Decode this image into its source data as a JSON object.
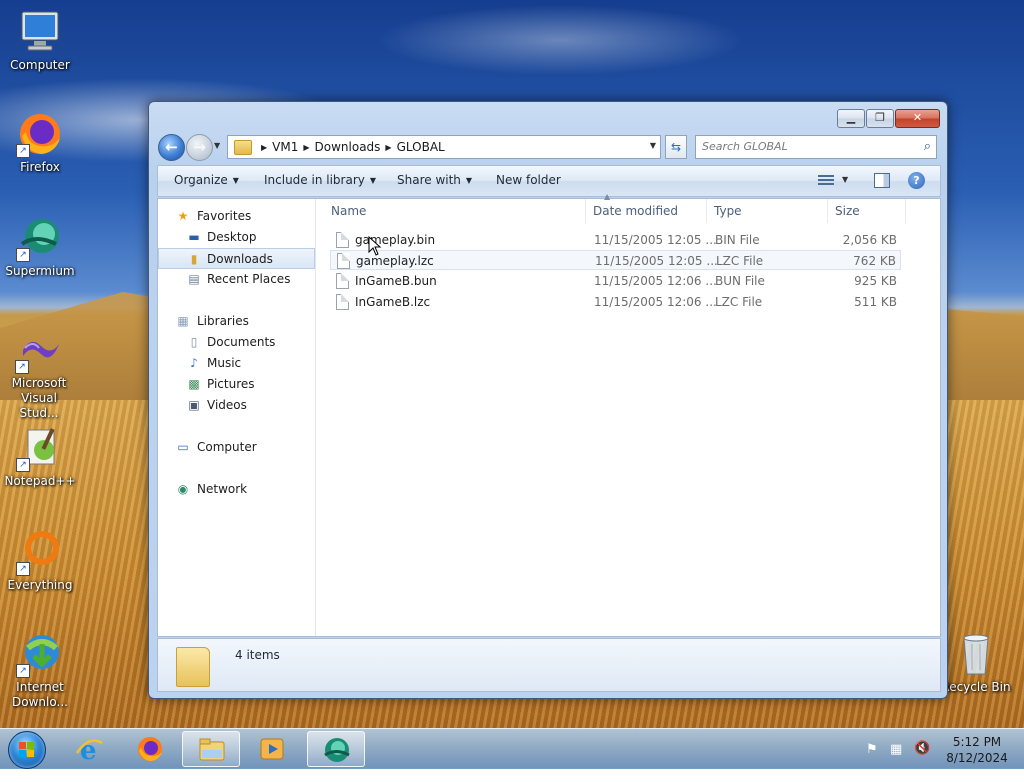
{
  "desktop": {
    "icons": [
      {
        "label": "Computer",
        "icon": "computer-icon"
      },
      {
        "label": "Firefox",
        "icon": "firefox-icon"
      },
      {
        "label": "Supermium",
        "icon": "supermium-icon"
      },
      {
        "label": "Microsoft Visual Stud...",
        "icon": "visual-studio-icon"
      },
      {
        "label": "Notepad++",
        "icon": "notepadpp-icon"
      },
      {
        "label": "Everything",
        "icon": "everything-icon"
      },
      {
        "label": "Internet Downlo...",
        "icon": "internet-download-manager-icon"
      },
      {
        "label": "Recycle Bin",
        "icon": "recycle-bin-icon"
      }
    ]
  },
  "window": {
    "address": {
      "crumbs": [
        "VM1",
        "Downloads",
        "GLOBAL"
      ]
    },
    "search": {
      "placeholder": "Search GLOBAL"
    },
    "toolbar": {
      "organize": "Organize",
      "include_in_library": "Include in library",
      "share_with": "Share with",
      "new_folder": "New folder"
    },
    "nav_pane": {
      "favorites": {
        "label": "Favorites",
        "items": [
          {
            "label": "Desktop",
            "icon": "desktop-icon"
          },
          {
            "label": "Downloads",
            "icon": "downloads-icon",
            "selected": true
          },
          {
            "label": "Recent Places",
            "icon": "recent-places-icon"
          }
        ]
      },
      "libraries": {
        "label": "Libraries",
        "items": [
          {
            "label": "Documents",
            "icon": "documents-icon"
          },
          {
            "label": "Music",
            "icon": "music-icon"
          },
          {
            "label": "Pictures",
            "icon": "pictures-icon"
          },
          {
            "label": "Videos",
            "icon": "videos-icon"
          }
        ]
      },
      "computer": {
        "label": "Computer"
      },
      "network": {
        "label": "Network"
      }
    },
    "file_list": {
      "columns": [
        "Name",
        "Date modified",
        "Type",
        "Size"
      ],
      "rows": [
        {
          "name": "gameplay.bin",
          "date": "11/15/2005 12:05 ...",
          "type": "BIN File",
          "size": "2,056 KB"
        },
        {
          "name": "gameplay.lzc",
          "date": "11/15/2005 12:05 ...",
          "type": "LZC File",
          "size": "762 KB"
        },
        {
          "name": "InGameB.bun",
          "date": "11/15/2005 12:06 ...",
          "type": "BUN File",
          "size": "925 KB"
        },
        {
          "name": "InGameB.lzc",
          "date": "11/15/2005 12:06 ...",
          "type": "LZC File",
          "size": "511 KB"
        }
      ]
    },
    "details": {
      "item_count": "4 items"
    }
  },
  "taskbar": {
    "apps": [
      "internet-explorer-icon",
      "firefox-icon",
      "file-explorer-icon",
      "media-player-icon",
      "supermium-icon"
    ],
    "active_app": "file-explorer-icon",
    "clock": {
      "time": "5:12 PM",
      "date": "8/12/2024"
    }
  }
}
